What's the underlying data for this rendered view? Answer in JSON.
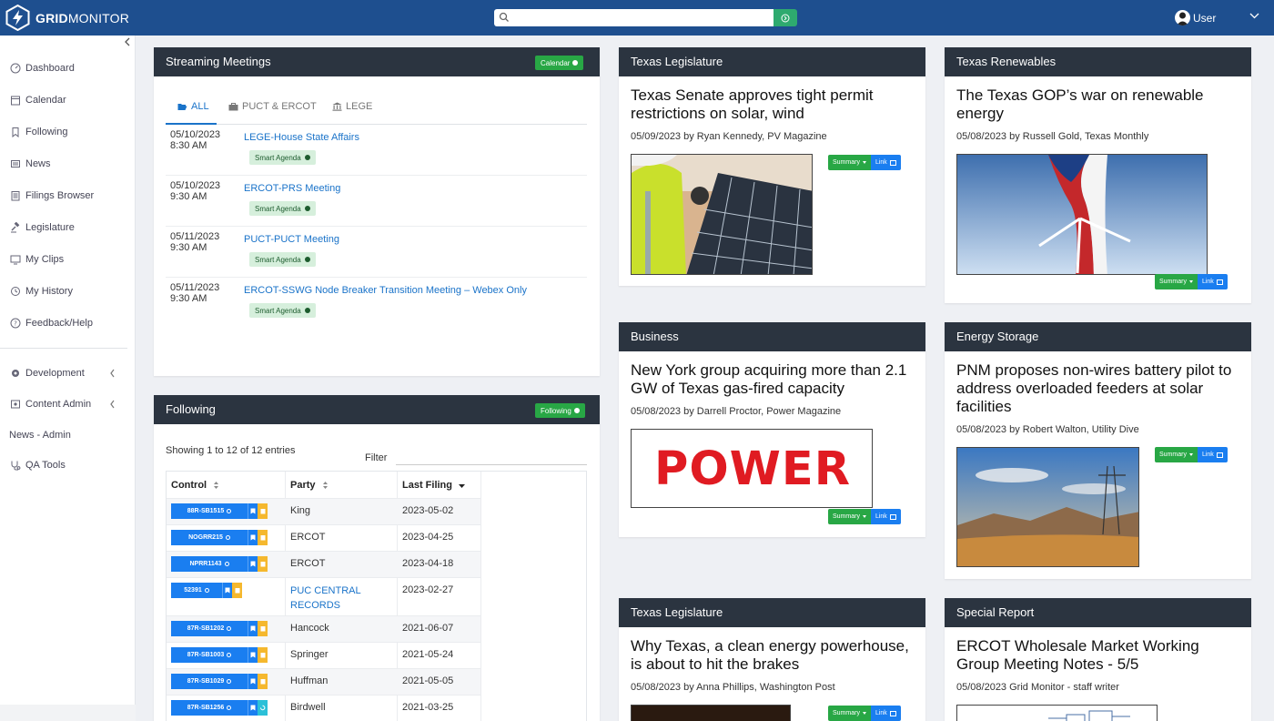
{
  "app": {
    "logo_bold": "GRID",
    "logo_light": "MONITOR"
  },
  "search": {
    "placeholder": ""
  },
  "user": {
    "label": "User"
  },
  "sidebar": {
    "items": [
      {
        "label": "Dashboard",
        "icon": "dashboard-icon"
      },
      {
        "label": "Calendar",
        "icon": "calendar-icon"
      },
      {
        "label": "Following",
        "icon": "bookmark-icon"
      },
      {
        "label": "News",
        "icon": "newspaper-icon"
      },
      {
        "label": "Filings Browser",
        "icon": "filings-icon"
      },
      {
        "label": "Legislature",
        "icon": "gavel-icon"
      },
      {
        "label": "My Clips",
        "icon": "clips-icon"
      },
      {
        "label": "My History",
        "icon": "history-icon"
      },
      {
        "label": "Feedback/Help",
        "icon": "help-icon"
      }
    ],
    "admin": [
      {
        "label": "Development",
        "icon": "cog-icon"
      },
      {
        "label": "Content Admin",
        "icon": "content-icon"
      },
      {
        "label": "News - Admin",
        "icon": ""
      },
      {
        "label": "QA Tools",
        "icon": "stethoscope-icon"
      }
    ]
  },
  "streaming": {
    "title": "Streaming Meetings",
    "button": "Calendar",
    "tabs": [
      "ALL",
      "PUCT & ERCOT",
      "LEGE"
    ],
    "meetings": [
      {
        "date": "05/10/2023",
        "time": "8:30 AM",
        "title": "LEGE-House State Affairs",
        "badge": "Smart Agenda"
      },
      {
        "date": "05/10/2023",
        "time": "9:30 AM",
        "title": "ERCOT-PRS Meeting",
        "badge": "Smart Agenda"
      },
      {
        "date": "05/11/2023",
        "time": "9:30 AM",
        "title": "PUCT-PUCT Meeting",
        "badge": "Smart Agenda"
      },
      {
        "date": "05/11/2023",
        "time": "9:30 AM",
        "title": "ERCOT-SSWG Node Breaker Transition Meeting – Webex Only",
        "badge": "Smart Agenda"
      }
    ]
  },
  "following": {
    "title": "Following",
    "button": "Following",
    "showing": "Showing 1 to 12 of 12 entries",
    "filter_label": "Filter",
    "columns": [
      "Control",
      "Party",
      "Last Filing"
    ],
    "rows": [
      {
        "control": "88R-SB1515",
        "party": "King",
        "last_filing": "2023-05-02",
        "extra": "yellow"
      },
      {
        "control": "NOGRR215",
        "party": "ERCOT",
        "last_filing": "2023-04-25",
        "extra": "yellow"
      },
      {
        "control": "NPRR1143",
        "party": "ERCOT",
        "last_filing": "2023-04-18",
        "extra": "yellow"
      },
      {
        "control": "52391",
        "party": "PUC CENTRAL RECORDS",
        "last_filing": "2023-02-27",
        "extra": "yellow"
      },
      {
        "control": "87R-SB1202",
        "party": "Hancock",
        "last_filing": "2021-06-07",
        "extra": "yellow"
      },
      {
        "control": "87R-SB1003",
        "party": "Springer",
        "last_filing": "2021-05-24",
        "extra": "yellow"
      },
      {
        "control": "87R-SB1029",
        "party": "Huffman",
        "last_filing": "2021-05-05",
        "extra": "yellow"
      },
      {
        "control": "87R-SB1256",
        "party": "Birdwell",
        "last_filing": "2021-03-25",
        "extra": "teal"
      }
    ]
  },
  "cards": [
    {
      "category": "Texas Legislature",
      "title": "Texas Senate approves tight permit restrictions on solar, wind",
      "byline": "05/09/2023 by Ryan Kennedy, PV Magazine",
      "summary": "Summary",
      "link": "Link",
      "image": "solar-panel-photo"
    },
    {
      "category": "Texas Renewables",
      "title": "The Texas GOP’s war on renewable energy",
      "byline": "05/08/2023 by Russell Gold, Texas Monthly",
      "summary": "Summary",
      "link": "Link",
      "image": "wind-turbine-flag-photo"
    },
    {
      "category": "Business",
      "title": "New York group acquiring more than 2.1 GW of Texas gas-fired capacity",
      "byline": "05/08/2023 by Darrell Proctor, Power Magazine",
      "summary": "Summary",
      "link": "Link",
      "image": "power-logo",
      "image_text": "POWER"
    },
    {
      "category": "Energy Storage",
      "title": "PNM proposes non-wires battery pilot to address overloaded feeders at solar facilities",
      "byline": "05/08/2023 by Robert Walton, Utility Dive",
      "summary": "Summary",
      "link": "Link",
      "image": "desert-powerline-photo"
    },
    {
      "category": "Texas Legislature",
      "title": "Why Texas, a clean energy powerhouse, is about to hit the brakes",
      "byline": "05/08/2023 by Anna Phillips, Washington Post",
      "summary": "Summary",
      "link": "Link",
      "image": "dark-photo"
    },
    {
      "category": "Special Report",
      "title": "ERCOT Wholesale Market Working Group Meeting Notes - 5/5",
      "byline": "05/08/2023 Grid Monitor - staff writer",
      "summary": "",
      "link": "",
      "image": "diagram-image"
    }
  ],
  "colors": {
    "topbar": "#1e4f8f",
    "panel_header": "#2b3440",
    "green": "#28a745",
    "blue": "#1a7ef0",
    "link": "#1a73c9",
    "yellow": "#f5b82e",
    "teal": "#2bc0d8"
  }
}
